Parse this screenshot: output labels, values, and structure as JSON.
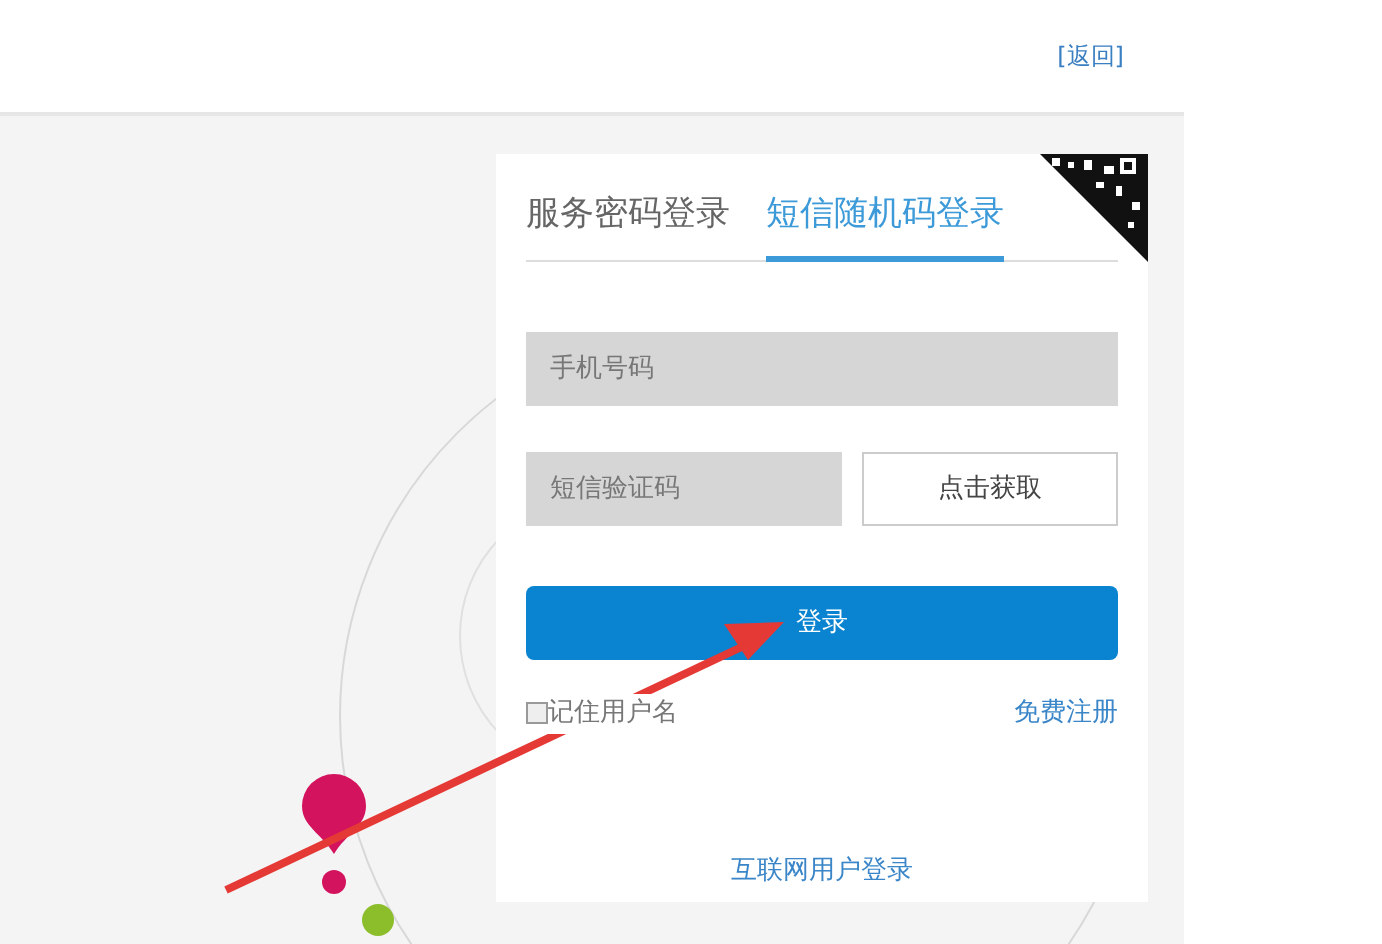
{
  "header": {
    "back_link": "[返回]"
  },
  "login": {
    "tabs": [
      {
        "label": "服务密码登录",
        "selected": false
      },
      {
        "label": "短信随机码登录",
        "selected": true
      }
    ],
    "phone_field": {
      "placeholder": "手机号码"
    },
    "code_field": {
      "placeholder": "短信验证码"
    },
    "get_code_button": "点击获取",
    "login_button": "登录",
    "remember": {
      "label": "记住用户名",
      "checked": false
    },
    "register_link": "免费注册",
    "internet_login_link": "互联网用户登录"
  }
}
